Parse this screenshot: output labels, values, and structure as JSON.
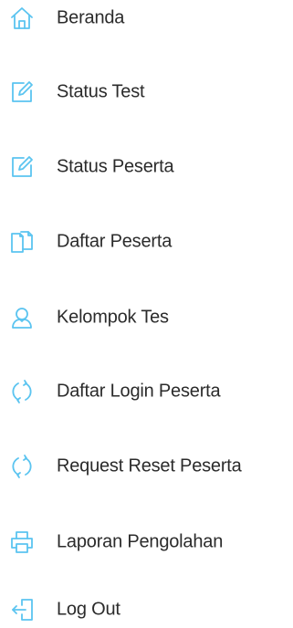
{
  "sidebar": {
    "accent_color": "#5bc4f0",
    "text_color": "#2b2b2b",
    "items": [
      {
        "label": "Beranda",
        "icon": "home-icon"
      },
      {
        "label": "Status Test",
        "icon": "edit-icon"
      },
      {
        "label": "Status Peserta",
        "icon": "edit-icon"
      },
      {
        "label": "Daftar Peserta",
        "icon": "documents-icon"
      },
      {
        "label": "Kelompok Tes",
        "icon": "user-icon"
      },
      {
        "label": "Daftar Login Peserta",
        "icon": "refresh-icon"
      },
      {
        "label": "Request Reset Peserta",
        "icon": "refresh-icon"
      },
      {
        "label": "Laporan Pengolahan",
        "icon": "printer-icon"
      },
      {
        "label": "Log Out",
        "icon": "logout-icon"
      }
    ]
  }
}
